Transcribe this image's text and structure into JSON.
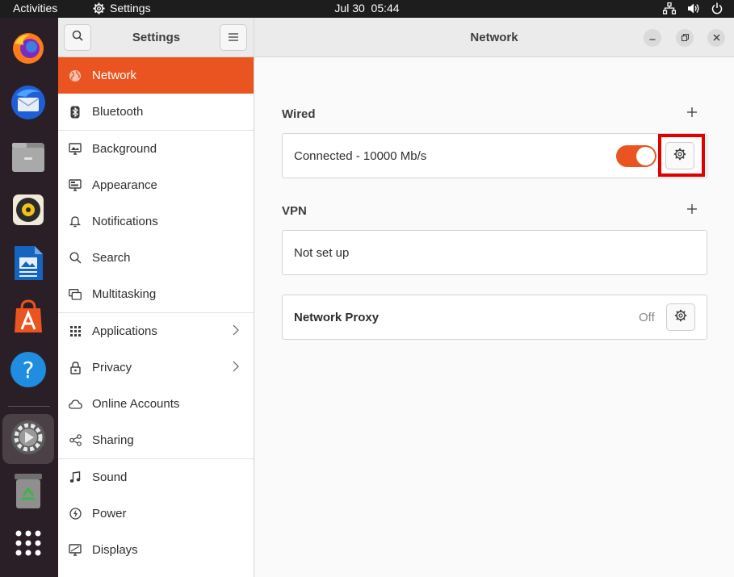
{
  "topbar": {
    "activities": "Activities",
    "app_name": "Settings",
    "clock": "Jul 30  05:44"
  },
  "dock": {
    "items": [
      "firefox",
      "thunderbird",
      "files",
      "rhythmbox",
      "libreoffice-writer",
      "ubuntu-software",
      "help",
      "settings",
      "trash",
      "show-applications"
    ],
    "active": "settings"
  },
  "headerbar": {
    "sidebar_title": "Settings",
    "page_title": "Network"
  },
  "sidebar": {
    "items": [
      {
        "label": "Network",
        "icon": "network-icon",
        "selected": true
      },
      {
        "label": "Bluetooth",
        "icon": "bluetooth-icon"
      },
      {
        "label": "Background",
        "icon": "background-icon"
      },
      {
        "label": "Appearance",
        "icon": "appearance-icon"
      },
      {
        "label": "Notifications",
        "icon": "bell-icon"
      },
      {
        "label": "Search",
        "icon": "search-icon"
      },
      {
        "label": "Multitasking",
        "icon": "multitasking-icon"
      },
      {
        "label": "Applications",
        "icon": "applications-icon",
        "has_submenu": true
      },
      {
        "label": "Privacy",
        "icon": "lock-icon",
        "has_submenu": true
      },
      {
        "label": "Online Accounts",
        "icon": "cloud-icon"
      },
      {
        "label": "Sharing",
        "icon": "share-icon"
      },
      {
        "label": "Sound",
        "icon": "music-note-icon"
      },
      {
        "label": "Power",
        "icon": "power-icon"
      },
      {
        "label": "Displays",
        "icon": "display-icon"
      }
    ]
  },
  "main": {
    "wired": {
      "title": "Wired",
      "connection_label": "Connected - 10000 Mb/s",
      "enabled": true
    },
    "vpn": {
      "title": "VPN",
      "status": "Not set up"
    },
    "proxy": {
      "label": "Network Proxy",
      "status": "Off"
    }
  },
  "colors": {
    "accent": "#e95420",
    "highlight": "#e00000"
  }
}
